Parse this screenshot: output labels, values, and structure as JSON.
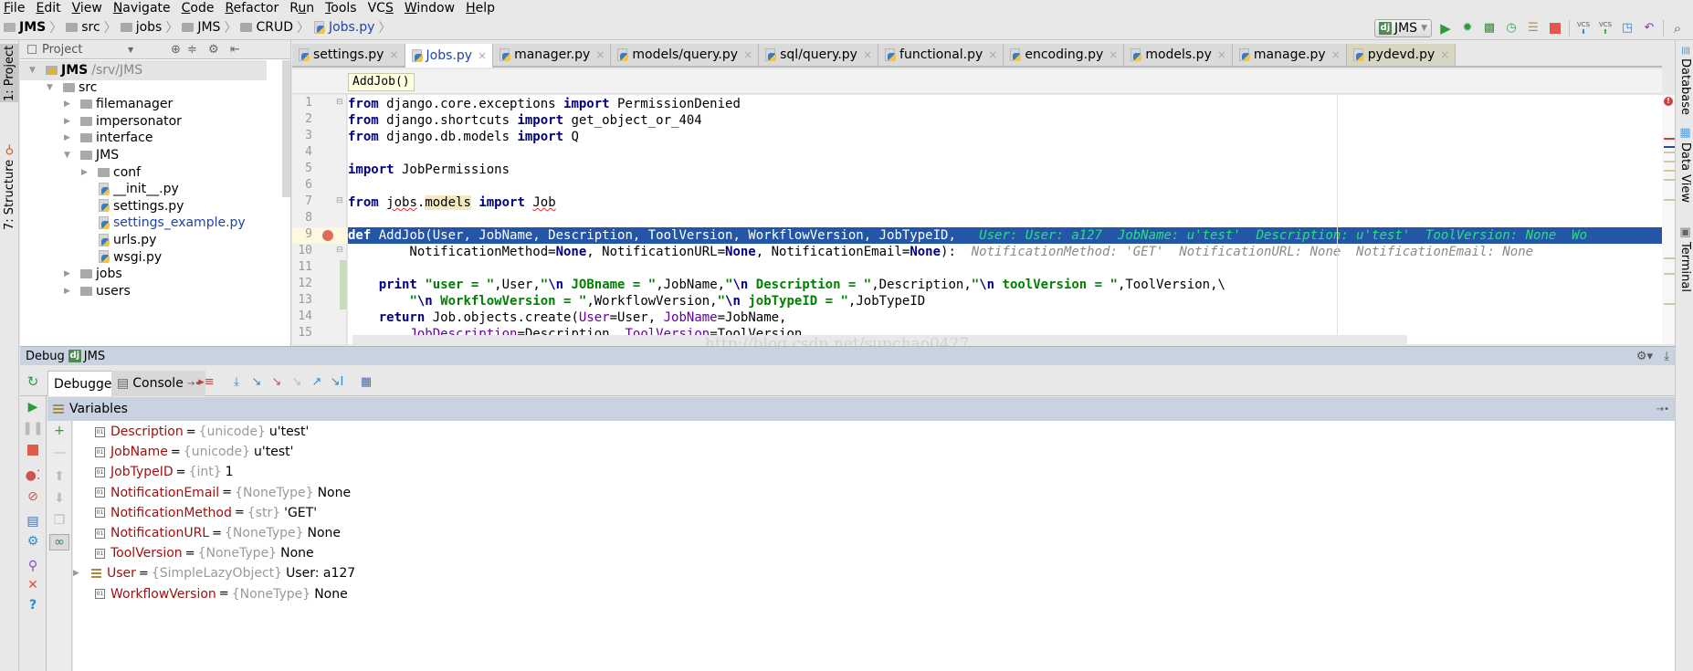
{
  "menu": [
    "File",
    "Edit",
    "View",
    "Navigate",
    "Code",
    "Refactor",
    "Run",
    "Tools",
    "VCS",
    "Window",
    "Help"
  ],
  "menu_mnemonics": [
    "F",
    "E",
    "V",
    "N",
    "C",
    "R",
    "u",
    "T",
    "S",
    "W",
    "H"
  ],
  "breadcrumb": [
    "JMS",
    "src",
    "jobs",
    "JMS",
    "CRUD",
    "Jobs.py"
  ],
  "run_config": {
    "label": "JMS",
    "icon": "django-icon"
  },
  "run_toolbar_icons": [
    "run-icon",
    "debug-icon",
    "coverage-icon",
    "profile-icon",
    "concurrency-icon",
    "stop-icon",
    "vcs-update-icon",
    "vcs-commit-icon",
    "vcs-history-icon",
    "revert-icon",
    "search-icon"
  ],
  "run_toolbar_labels": {
    "vcs": "VCS"
  },
  "left_stripe": {
    "project": "1: Project",
    "structure": "7: Structure"
  },
  "right_stripe": {
    "database": "Database",
    "data_view": "Data View",
    "terminal": "Terminal"
  },
  "project_panel": {
    "title": "Project",
    "tree": [
      {
        "label": "JMS",
        "suffix": "/srv/JMS",
        "type": "module",
        "expanded": true,
        "depth": 0,
        "bold": true
      },
      {
        "label": "src",
        "type": "folder",
        "expanded": true,
        "depth": 1
      },
      {
        "label": "filemanager",
        "type": "folder",
        "expanded": false,
        "depth": 2
      },
      {
        "label": "impersonator",
        "type": "folder",
        "expanded": false,
        "depth": 2
      },
      {
        "label": "interface",
        "type": "folder",
        "expanded": false,
        "depth": 2
      },
      {
        "label": "JMS",
        "type": "folder",
        "expanded": true,
        "depth": 2
      },
      {
        "label": "conf",
        "type": "folder",
        "expanded": false,
        "depth": 3
      },
      {
        "label": "__init__.py",
        "type": "py",
        "depth": 3
      },
      {
        "label": "settings.py",
        "type": "py",
        "depth": 3
      },
      {
        "label": "settings_example.py",
        "type": "py",
        "depth": 3,
        "modified": true
      },
      {
        "label": "urls.py",
        "type": "py",
        "depth": 3
      },
      {
        "label": "wsgi.py",
        "type": "py",
        "depth": 3
      },
      {
        "label": "jobs",
        "type": "folder",
        "expanded": false,
        "depth": 2
      },
      {
        "label": "users",
        "type": "folder",
        "expanded": false,
        "depth": 2
      }
    ]
  },
  "editor": {
    "tabs": [
      {
        "label": "settings.py",
        "active": false
      },
      {
        "label": "Jobs.py",
        "active": true
      },
      {
        "label": "manager.py",
        "active": false
      },
      {
        "label": "models/query.py",
        "active": false
      },
      {
        "label": "sql/query.py",
        "active": false
      },
      {
        "label": "functional.py",
        "active": false
      },
      {
        "label": "encoding.py",
        "active": false
      },
      {
        "label": "models.py",
        "active": false
      },
      {
        "label": "manage.py",
        "active": false
      },
      {
        "label": "pydevd.py",
        "active": false,
        "pinned": true
      }
    ],
    "function_crumb": "AddJob()",
    "line_numbers": [
      "1",
      "2",
      "3",
      "4",
      "5",
      "6",
      "7",
      "8",
      "9",
      "10",
      "11",
      "12",
      "13",
      "14",
      "15"
    ],
    "current_line": 9,
    "breakpoint_line": 9,
    "inline_values": {
      "line9": "User: User: a127  JobName: u'test'  Description: u'test'  ToolVersion: None  Wo",
      "line10": "NotificationMethod: 'GET'  NotificationURL: None  NotificationEmail: None"
    },
    "watermark": "http://blog.csdn.net/sunchao0427"
  },
  "debug": {
    "title": "Debug",
    "config": "JMS",
    "tabs": [
      {
        "label": "Debugger",
        "active": true
      },
      {
        "label": "Console",
        "active": false
      }
    ],
    "variables_title": "Variables",
    "variables": [
      {
        "name": "Description",
        "type": "{unicode}",
        "value": "u'test'",
        "expandable": false
      },
      {
        "name": "JobName",
        "type": "{unicode}",
        "value": "u'test'",
        "expandable": false
      },
      {
        "name": "JobTypeID",
        "type": "{int}",
        "value": "1",
        "expandable": false
      },
      {
        "name": "NotificationEmail",
        "type": "{NoneType}",
        "value": "None",
        "expandable": false
      },
      {
        "name": "NotificationMethod",
        "type": "{str}",
        "value": "'GET'",
        "expandable": false
      },
      {
        "name": "NotificationURL",
        "type": "{NoneType}",
        "value": "None",
        "expandable": false
      },
      {
        "name": "ToolVersion",
        "type": "{NoneType}",
        "value": "None",
        "expandable": false
      },
      {
        "name": "User",
        "type": "{SimpleLazyObject}",
        "value": "User: a127",
        "expandable": true
      },
      {
        "name": "WorkflowVersion",
        "type": "{NoneType}",
        "value": "None",
        "expandable": false
      }
    ]
  },
  "colors": {
    "selection": "#2456a8",
    "keyword": "#000080",
    "string": "#008000",
    "param": "#660099",
    "var_name": "#a01010",
    "panel_header": "#c8d2e0",
    "inline_hl": "#28e07a"
  }
}
